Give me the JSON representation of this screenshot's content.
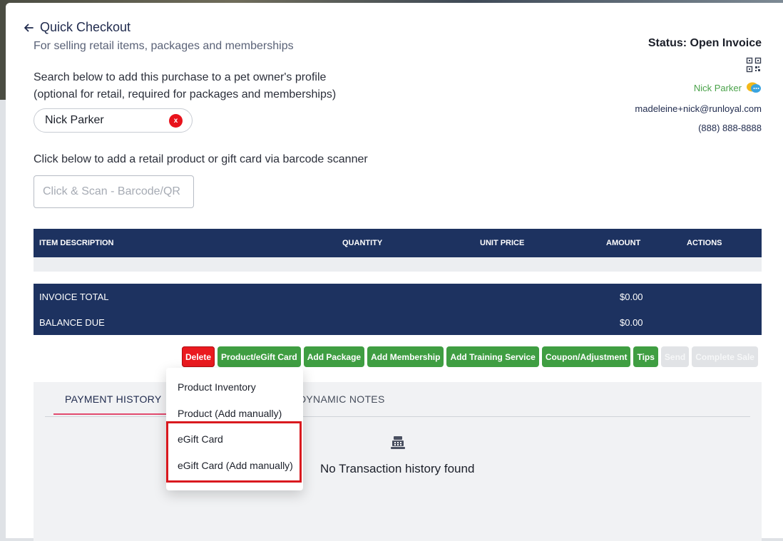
{
  "header": {
    "title": "Quick Checkout",
    "subtitle": "For selling retail items, packages and memberships",
    "search_hint_line1": "Search below to add this purchase to a pet owner's profile",
    "search_hint_line2": "(optional for retail, required for packages and memberships)",
    "selected_owner": "Nick Parker",
    "clear_label": "x",
    "scan_hint": "Click below to add a retail product or gift card via barcode scanner",
    "scan_placeholder": "Click & Scan - Barcode/QR"
  },
  "status": {
    "label": "Status: Open Invoice",
    "owner_name": "Nick Parker",
    "email": "madeleine+nick@runloyal.com",
    "phone": "(888) 888-8888"
  },
  "table": {
    "columns": [
      "ITEM DESCRIPTION",
      "QUANTITY",
      "UNIT PRICE",
      "AMOUNT",
      "ACTIONS"
    ],
    "totals": [
      {
        "label": "INVOICE TOTAL",
        "value": "$0.00"
      },
      {
        "label": "BALANCE DUE",
        "value": "$0.00"
      }
    ]
  },
  "buttons": {
    "delete": "Delete",
    "product_egift": "Product/eGift Card",
    "add_package": "Add Package",
    "add_membership": "Add Membership",
    "add_training": "Add Training Service",
    "coupon": "Coupon/Adjustment",
    "tips": "Tips",
    "send": "Send",
    "complete_sale": "Complete Sale"
  },
  "dropdown": {
    "items": [
      "Product Inventory",
      "Product (Add manually)",
      "eGift Card",
      "eGift Card (Add manually)"
    ]
  },
  "history": {
    "tab_payment": "PAYMENT HISTORY",
    "tab_notes": "DYNAMIC NOTES",
    "empty_message": "No Transaction history found"
  },
  "colors": {
    "navy": "#1d3260",
    "green": "#3f9e42",
    "red": "#ea1a1f",
    "highlight": "#d9191f"
  },
  "icons": [
    "back-arrow-icon",
    "clear-icon",
    "qr-code-icon",
    "chat-icon",
    "cash-register-icon"
  ]
}
